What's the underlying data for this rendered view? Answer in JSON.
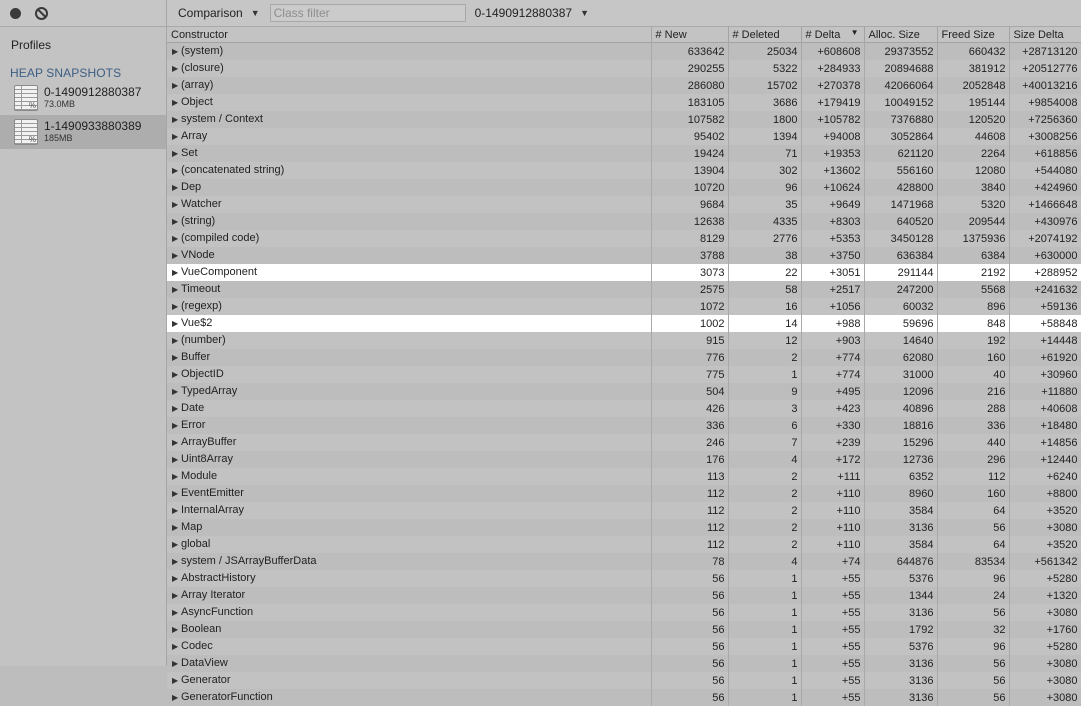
{
  "toolbar": {
    "record_icon": "record-icon",
    "clear_icon": "clear-icon"
  },
  "sidebar": {
    "title": "Profiles",
    "section_title": "HEAP SNAPSHOTS",
    "snapshots": [
      {
        "name": "0-1490912880387",
        "size": "73.0MB",
        "icon_badge": "%"
      },
      {
        "name": "1-1490933880389",
        "size": "185MB",
        "icon_badge": "%",
        "selected": true
      }
    ]
  },
  "main_toolbar": {
    "view": "Comparison",
    "filter_placeholder": "Class filter",
    "filter_value": "",
    "base_snapshot": "0-1490912880387"
  },
  "table": {
    "columns": [
      "Constructor",
      "# New",
      "# Deleted",
      "# Delta",
      "Alloc. Size",
      "Freed Size",
      "Size Delta"
    ],
    "sorted_column": "# Delta",
    "sort_direction": "descending",
    "rows": [
      [
        "(system)",
        "633642",
        "25034",
        "+608608",
        "29373552",
        "660432",
        "+28713120"
      ],
      [
        "(closure)",
        "290255",
        "5322",
        "+284933",
        "20894688",
        "381912",
        "+20512776"
      ],
      [
        "(array)",
        "286080",
        "15702",
        "+270378",
        "42066064",
        "2052848",
        "+40013216"
      ],
      [
        "Object",
        "183105",
        "3686",
        "+179419",
        "10049152",
        "195144",
        "+9854008"
      ],
      [
        "system / Context",
        "107582",
        "1800",
        "+105782",
        "7376880",
        "120520",
        "+7256360"
      ],
      [
        "Array",
        "95402",
        "1394",
        "+94008",
        "3052864",
        "44608",
        "+3008256"
      ],
      [
        "Set",
        "19424",
        "71",
        "+19353",
        "621120",
        "2264",
        "+618856"
      ],
      [
        "(concatenated string)",
        "13904",
        "302",
        "+13602",
        "556160",
        "12080",
        "+544080"
      ],
      [
        "Dep",
        "10720",
        "96",
        "+10624",
        "428800",
        "3840",
        "+424960"
      ],
      [
        "Watcher",
        "9684",
        "35",
        "+9649",
        "1471968",
        "5320",
        "+1466648"
      ],
      [
        "(string)",
        "12638",
        "4335",
        "+8303",
        "640520",
        "209544",
        "+430976"
      ],
      [
        "(compiled code)",
        "8129",
        "2776",
        "+5353",
        "3450128",
        "1375936",
        "+2074192"
      ],
      [
        "VNode",
        "3788",
        "38",
        "+3750",
        "636384",
        "6384",
        "+630000"
      ],
      [
        "VueComponent",
        "3073",
        "22",
        "+3051",
        "291144",
        "2192",
        "+288952"
      ],
      [
        "Timeout",
        "2575",
        "58",
        "+2517",
        "247200",
        "5568",
        "+241632"
      ],
      [
        "(regexp)",
        "1072",
        "16",
        "+1056",
        "60032",
        "896",
        "+59136"
      ],
      [
        "Vue$2",
        "1002",
        "14",
        "+988",
        "59696",
        "848",
        "+58848"
      ],
      [
        "(number)",
        "915",
        "12",
        "+903",
        "14640",
        "192",
        "+14448"
      ],
      [
        "Buffer",
        "776",
        "2",
        "+774",
        "62080",
        "160",
        "+61920"
      ],
      [
        "ObjectID",
        "775",
        "1",
        "+774",
        "31000",
        "40",
        "+30960"
      ],
      [
        "TypedArray",
        "504",
        "9",
        "+495",
        "12096",
        "216",
        "+11880"
      ],
      [
        "Date",
        "426",
        "3",
        "+423",
        "40896",
        "288",
        "+40608"
      ],
      [
        "Error",
        "336",
        "6",
        "+330",
        "18816",
        "336",
        "+18480"
      ],
      [
        "ArrayBuffer",
        "246",
        "7",
        "+239",
        "15296",
        "440",
        "+14856"
      ],
      [
        "Uint8Array",
        "176",
        "4",
        "+172",
        "12736",
        "296",
        "+12440"
      ],
      [
        "Module",
        "113",
        "2",
        "+111",
        "6352",
        "112",
        "+6240"
      ],
      [
        "EventEmitter",
        "112",
        "2",
        "+110",
        "8960",
        "160",
        "+8800"
      ],
      [
        "InternalArray",
        "112",
        "2",
        "+110",
        "3584",
        "64",
        "+3520"
      ],
      [
        "Map",
        "112",
        "2",
        "+110",
        "3136",
        "56",
        "+3080"
      ],
      [
        "global",
        "112",
        "2",
        "+110",
        "3584",
        "64",
        "+3520"
      ],
      [
        "system / JSArrayBufferData",
        "78",
        "4",
        "+74",
        "644876",
        "83534",
        "+561342"
      ],
      [
        "AbstractHistory",
        "56",
        "1",
        "+55",
        "5376",
        "96",
        "+5280"
      ],
      [
        "Array Iterator",
        "56",
        "1",
        "+55",
        "1344",
        "24",
        "+1320"
      ],
      [
        "AsyncFunction",
        "56",
        "1",
        "+55",
        "3136",
        "56",
        "+3080"
      ],
      [
        "Boolean",
        "56",
        "1",
        "+55",
        "1792",
        "32",
        "+1760"
      ],
      [
        "Codec",
        "56",
        "1",
        "+55",
        "5376",
        "96",
        "+5280"
      ],
      [
        "DataView",
        "56",
        "1",
        "+55",
        "3136",
        "56",
        "+3080"
      ],
      [
        "Generator",
        "56",
        "1",
        "+55",
        "3136",
        "56",
        "+3080"
      ],
      [
        "GeneratorFunction",
        "56",
        "1",
        "+55",
        "3136",
        "56",
        "+3080"
      ]
    ],
    "highlighted_rows": [
      "VueComponent",
      "Vue$2"
    ]
  }
}
